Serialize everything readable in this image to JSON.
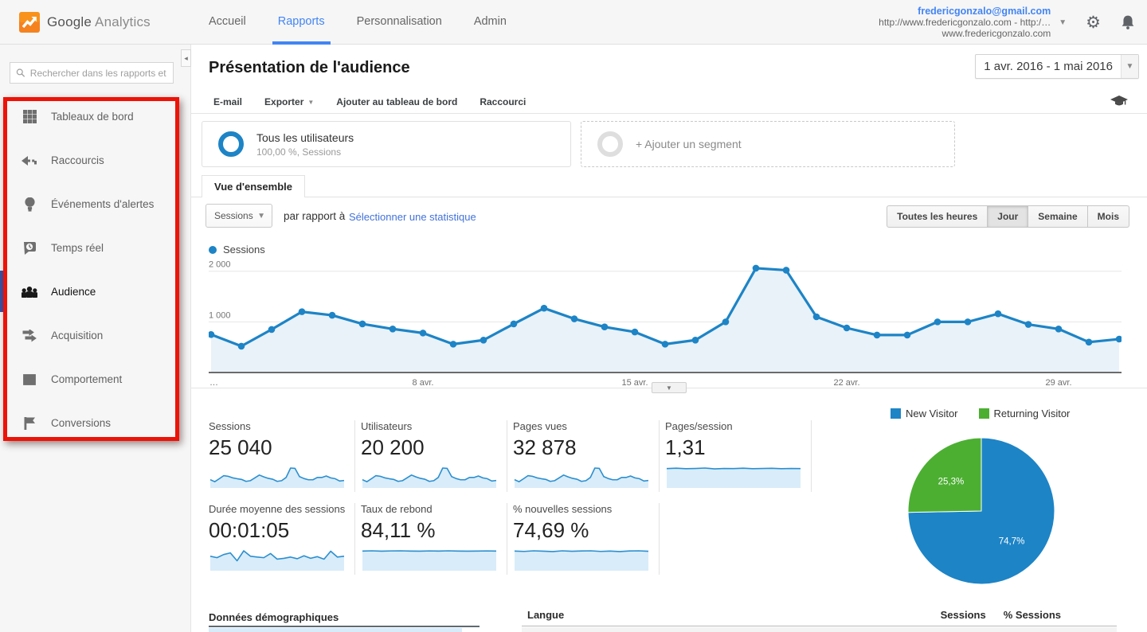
{
  "colors": {
    "accent_blue": "#4285f4",
    "chart_blue": "#1d84c6",
    "chart_fill": "#e9f2f9",
    "spark_line": "#2b8fd0",
    "spark_fill": "#d9ecf9",
    "pie_green": "#4caf32",
    "annotation_red": "#ee1207"
  },
  "header": {
    "brand_primary": "Google",
    "brand_secondary": "Analytics",
    "nav": [
      {
        "label": "Accueil"
      },
      {
        "label": "Rapports"
      },
      {
        "label": "Personnalisation"
      },
      {
        "label": "Admin"
      }
    ],
    "account": {
      "email": "fredericgonzalo@gmail.com",
      "property_line": "http://www.fredericgonzalo.com - http:/…",
      "view_line": "www.fredericgonzalo.com"
    }
  },
  "sidebar": {
    "search_placeholder": "Rechercher dans les rapports et",
    "items": [
      {
        "label": "Tableaux de bord"
      },
      {
        "label": "Raccourcis"
      },
      {
        "label": "Événements d'alertes"
      },
      {
        "label": "Temps réel"
      },
      {
        "label": "Audience"
      },
      {
        "label": "Acquisition"
      },
      {
        "label": "Comportement"
      },
      {
        "label": "Conversions"
      }
    ]
  },
  "main": {
    "title": "Présentation de l'audience",
    "date_range": "1 avr. 2016 - 1 mai 2016",
    "toolbar": {
      "email": "E-mail",
      "export": "Exporter",
      "add_dashboard": "Ajouter au tableau de bord",
      "shortcut": "Raccourci"
    },
    "segments": {
      "all_users_title": "Tous les utilisateurs",
      "all_users_subtitle": "100,00 %, Sessions",
      "add_segment": "+ Ajouter un segment"
    },
    "tab": "Vue d'ensemble",
    "controls": {
      "metric": "Sessions",
      "vs": "par rapport à",
      "stat_link": "Sélectionner une statistique",
      "granularity": [
        "Toutes les heures",
        "Jour",
        "Semaine",
        "Mois"
      ],
      "active_granularity": "Jour"
    },
    "chart_legend": "Sessions"
  },
  "chart_data": [
    {
      "type": "area",
      "series": [
        {
          "name": "Sessions",
          "values": [
            750,
            520,
            850,
            1200,
            1130,
            960,
            860,
            780,
            560,
            640,
            960,
            1270,
            1060,
            900,
            800,
            560,
            640,
            1000,
            2060,
            2020,
            1100,
            880,
            740,
            740,
            1000,
            1000,
            1160,
            950,
            860,
            600,
            660
          ]
        }
      ],
      "x_tick_labels": [
        "…",
        "8 avr.",
        "15 avr.",
        "22 avr.",
        "29 avr."
      ],
      "x_tick_positions": [
        0,
        7,
        14,
        21,
        28
      ],
      "y_ticks": [
        1000,
        2000
      ],
      "y_tick_labels": [
        "1 000",
        "2 000"
      ],
      "ylim": [
        0,
        2200
      ],
      "grid": true,
      "legend_position": "top-left"
    },
    {
      "type": "pie",
      "slices": [
        {
          "label": "New Visitor",
          "value": 74.7,
          "display": "74,7%",
          "color": "#1d84c6"
        },
        {
          "label": "Returning Visitor",
          "value": 25.3,
          "display": "25,3%",
          "color": "#4caf32"
        }
      ],
      "legend_position": "top"
    }
  ],
  "metrics": {
    "row1": [
      {
        "label": "Sessions",
        "value": "25 040",
        "spark": "daily"
      },
      {
        "label": "Utilisateurs",
        "value": "20 200",
        "spark": "daily"
      },
      {
        "label": "Pages vues",
        "value": "32 878",
        "spark": "daily"
      },
      {
        "label": "Pages/session",
        "value": "1,31",
        "spark": [
          1.3,
          1.33,
          1.29,
          1.31,
          1.34,
          1.28,
          1.31,
          1.3,
          1.33,
          1.29,
          1.31,
          1.32,
          1.29,
          1.31,
          1.3
        ]
      }
    ],
    "row2": [
      {
        "label": "Durée moyenne des sessions",
        "value": "00:01:05",
        "spark": [
          62,
          55,
          70,
          78,
          40,
          88,
          62,
          58,
          55,
          75,
          48,
          52,
          58,
          50,
          64,
          52,
          60,
          48,
          86,
          58,
          62
        ]
      },
      {
        "label": "Taux de rebond",
        "value": "84,11 %",
        "spark": [
          84,
          85,
          83.5,
          84.5,
          85,
          84,
          83.5,
          84.5,
          84,
          85,
          84,
          83.5,
          84,
          84.5,
          84
        ]
      },
      {
        "label": "% nouvelles sessions",
        "value": "74,69 %",
        "spark": [
          75,
          73.5,
          76,
          74.5,
          73,
          76,
          74,
          75.5,
          76,
          73.5,
          75,
          73,
          75.5,
          76,
          74
        ]
      }
    ]
  },
  "bottom": {
    "demographics_title": "Données démographiques",
    "language_header": "Langue",
    "sessions_header": "Sessions",
    "pct_sessions_header": "% Sessions"
  }
}
